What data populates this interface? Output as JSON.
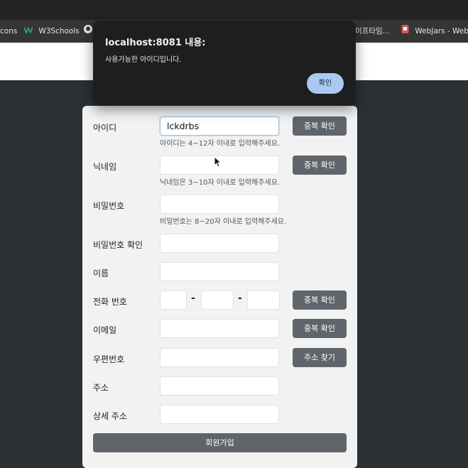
{
  "browser": {
    "bookmarks": [
      {
        "label": "cons",
        "icon": "none"
      },
      {
        "label": "W3Schools",
        "icon": "w3schools-icon"
      },
      {
        "label": "",
        "icon": "github-icon"
      },
      {
        "label": "이프타임...",
        "icon": "none"
      },
      {
        "label": "WebJars - Web l",
        "icon": "webjars-icon"
      }
    ]
  },
  "dialog": {
    "title": "localhost:8081 내용:",
    "message": "사용가능한 아이디입니다.",
    "ok_label": "확인"
  },
  "form": {
    "id": {
      "label": "아이디",
      "value": "lckdrbs",
      "hint": "아이디는 4~12자 이내로 입력해주세요.",
      "button": "중복 확인"
    },
    "nickname": {
      "label": "닉네임",
      "value": "",
      "hint": "닉네임은 3~10자 이내로 입력해주세요.",
      "button": "중복 확인"
    },
    "password": {
      "label": "비밀번호",
      "value": "",
      "hint": "비밀번호는 8~20자 이내로 입력해주세요."
    },
    "password_confirm": {
      "label": "비밀번호 확인",
      "value": ""
    },
    "name": {
      "label": "이름",
      "value": ""
    },
    "phone": {
      "label": "전화 번호",
      "sep": "-",
      "button": "중복 확인"
    },
    "email": {
      "label": "이메일",
      "value": "",
      "button": "중복 확인"
    },
    "postcode": {
      "label": "우편번호",
      "value": "",
      "button": "주소 찾기"
    },
    "address": {
      "label": "주소",
      "value": ""
    },
    "address_detail": {
      "label": "상세 주소",
      "value": ""
    },
    "submit_label": "회원가입"
  },
  "colors": {
    "accent_button": "#5f656b",
    "dialog_bg": "#1e1e1e",
    "dialog_ok": "#a9c9f3"
  }
}
